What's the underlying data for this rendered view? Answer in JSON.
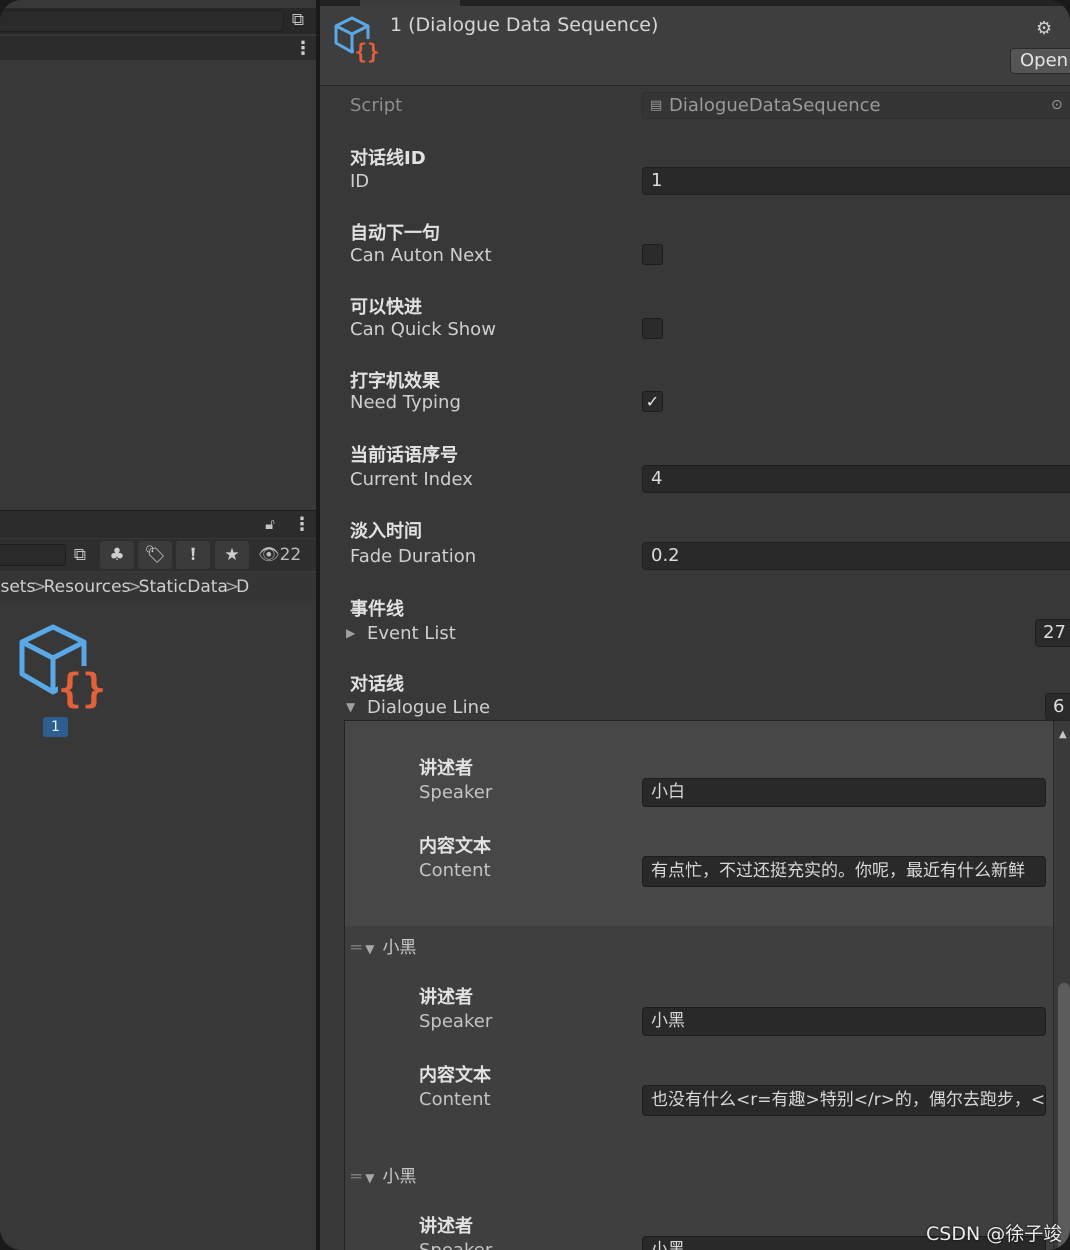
{
  "project": {
    "breadcrumb": [
      "Assets",
      "Resources",
      "StaticData",
      "D"
    ],
    "hidden_count": "22",
    "asset_label": "1"
  },
  "inspector": {
    "title": "1 (Dialogue Data Sequence)",
    "open_label": "Open",
    "script_label": "Script",
    "script_value": "DialogueDataSequence",
    "fields": {
      "id": {
        "zh": "对话线ID",
        "label": "ID",
        "value": "1"
      },
      "auto_next": {
        "zh": "自动下一句",
        "label": "Can Auton Next",
        "checked": false
      },
      "quick_show": {
        "zh": "可以快进",
        "label": "Can Quick Show",
        "checked": false
      },
      "need_typing": {
        "zh": "打字机效果",
        "label": "Need Typing",
        "checked": true,
        "check_glyph": "✓"
      },
      "current_index": {
        "zh": "当前话语序号",
        "label": "Current Index",
        "value": "4"
      },
      "fade_duration": {
        "zh": "淡入时间",
        "label": "Fade Duration",
        "value": "0.2"
      },
      "event_list": {
        "zh": "事件线",
        "label": "Event List",
        "count": "27"
      },
      "dialogue_line": {
        "zh": "对话线",
        "label": "Dialogue Line",
        "count": "6"
      }
    },
    "elements": [
      {
        "header": "",
        "speaker_zh": "讲述者",
        "speaker_label": "Speaker",
        "speaker_value": "小白",
        "content_zh": "内容文本",
        "content_label": "Content",
        "content_value": "有点忙，不过还挺充实的。你呢，最近有什么新鲜"
      },
      {
        "header": "小黑",
        "speaker_zh": "讲述者",
        "speaker_label": "Speaker",
        "speaker_value": "小黑",
        "content_zh": "内容文本",
        "content_label": "Content",
        "content_value": "也没有什么<r=有趣>特别</r>的，偶尔去跑步，<"
      },
      {
        "header": "小黑",
        "speaker_zh": "讲述者",
        "speaker_label": "Speaker",
        "speaker_value": "小黑"
      }
    ]
  },
  "watermark": "CSDN @徐子竣",
  "colors": {
    "accent_blue": "#5aa9e6",
    "accent_orange": "#e2603a",
    "badge_blue": "#2e5d8f"
  }
}
